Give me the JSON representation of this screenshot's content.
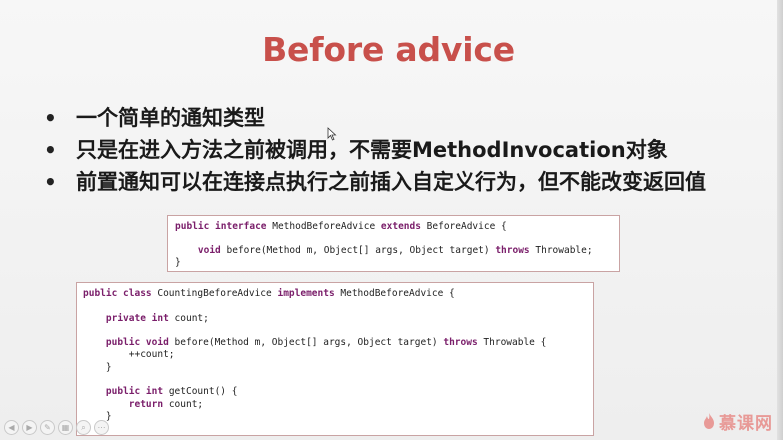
{
  "slide": {
    "title": "Before advice",
    "bullets": [
      "一个简单的通知类型",
      "只是在进入方法之前被调用，不需要MethodInvocation对象",
      "前置通知可以在连接点执行之前插入自定义行为，但不能改变返回值"
    ]
  },
  "code_interface": [
    [
      {
        "t": "public interface ",
        "k": true
      },
      {
        "t": "MethodBeforeAdvice "
      },
      {
        "t": "extends ",
        "k": true
      },
      {
        "t": "BeforeAdvice {"
      }
    ],
    [
      {
        "t": ""
      }
    ],
    [
      {
        "t": "    "
      },
      {
        "t": "void ",
        "k": true
      },
      {
        "t": "before(Method m, Object[] args, Object target) "
      },
      {
        "t": "throws ",
        "k": true
      },
      {
        "t": "Throwable;"
      }
    ],
    [
      {
        "t": "}"
      }
    ]
  ],
  "code_class": [
    [
      {
        "t": "public class ",
        "k": true
      },
      {
        "t": "CountingBeforeAdvice "
      },
      {
        "t": "implements ",
        "k": true
      },
      {
        "t": "MethodBeforeAdvice {"
      }
    ],
    [
      {
        "t": ""
      }
    ],
    [
      {
        "t": "    "
      },
      {
        "t": "private int ",
        "k": true
      },
      {
        "t": "count;"
      }
    ],
    [
      {
        "t": ""
      }
    ],
    [
      {
        "t": "    "
      },
      {
        "t": "public void ",
        "k": true
      },
      {
        "t": "before(Method m, Object[] args, Object target) "
      },
      {
        "t": "throws ",
        "k": true
      },
      {
        "t": "Throwable {"
      }
    ],
    [
      {
        "t": "        ++count;"
      }
    ],
    [
      {
        "t": "    }"
      }
    ],
    [
      {
        "t": ""
      }
    ],
    [
      {
        "t": "    "
      },
      {
        "t": "public int ",
        "k": true
      },
      {
        "t": "getCount() {"
      }
    ],
    [
      {
        "t": "        "
      },
      {
        "t": "return ",
        "k": true
      },
      {
        "t": "count;"
      }
    ],
    [
      {
        "t": "    }"
      }
    ],
    [
      {
        "t": "}"
      }
    ]
  ],
  "toolbar": {
    "buttons": [
      {
        "name": "prev-slide-icon",
        "glyph": "◀"
      },
      {
        "name": "next-slide-icon",
        "glyph": "▶"
      },
      {
        "name": "pen-icon",
        "glyph": "✎"
      },
      {
        "name": "slides-grid-icon",
        "glyph": "▦"
      },
      {
        "name": "zoom-icon",
        "glyph": "⌕"
      },
      {
        "name": "more-options-icon",
        "glyph": "⋯"
      }
    ]
  },
  "watermark": {
    "brand_text": "慕课网",
    "color": "#e89a97"
  },
  "colors": {
    "title": "#c8504b",
    "keyword": "#7a1e6a",
    "code_border": "#c9a3a3"
  }
}
